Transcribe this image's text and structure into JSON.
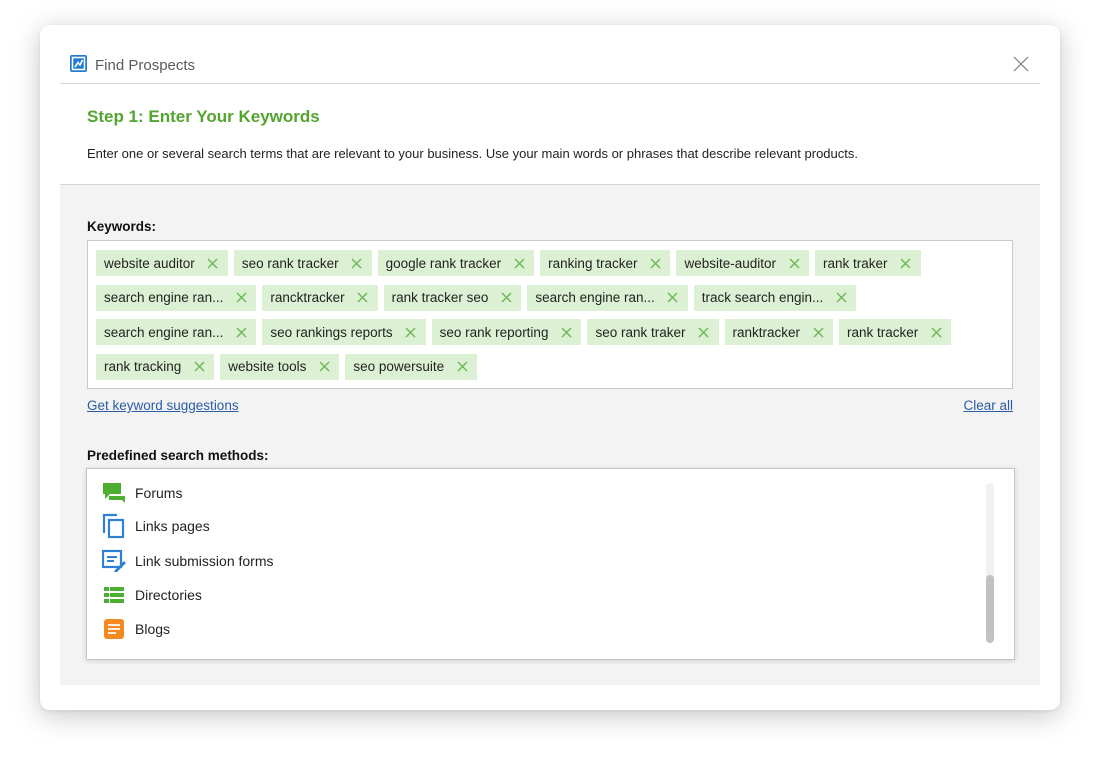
{
  "dialog": {
    "title": "Find Prospects",
    "step_title": "Step 1: Enter Your Keywords",
    "step_description": "Enter one or several search terms that are relevant to your business. Use your main words or phrases that describe relevant products."
  },
  "keywords": {
    "label": "Keywords:",
    "rows": [
      [
        "website auditor",
        "seo rank tracker",
        "google rank tracker",
        "ranking tracker",
        "website-auditor",
        "rank traker"
      ],
      [
        "search engine ran...",
        "rancktracker",
        "rank tracker seo",
        "search engine ran...",
        "track search engin..."
      ],
      [
        "search engine ran...",
        "seo rankings reports",
        "seo rank reporting",
        "seo rank traker",
        "ranktracker",
        "rank tracker"
      ],
      [
        "rank tracking",
        "website tools",
        "seo powersuite"
      ]
    ],
    "suggest_link": "Get keyword suggestions",
    "clear_link": "Clear all"
  },
  "methods": {
    "label": "Predefined search methods:",
    "items": [
      {
        "label": "Forums",
        "icon": "forums-icon"
      },
      {
        "label": "Links pages",
        "icon": "links-pages-icon"
      },
      {
        "label": "Link submission forms",
        "icon": "link-submission-icon"
      },
      {
        "label": "Directories",
        "icon": "directories-icon"
      },
      {
        "label": "Blogs",
        "icon": "blogs-icon"
      }
    ],
    "scroll_position": 0.57
  },
  "colors": {
    "accent_green": "#52a52e",
    "tag_bg": "#dcf1d3",
    "link_blue": "#2a5ba8"
  }
}
